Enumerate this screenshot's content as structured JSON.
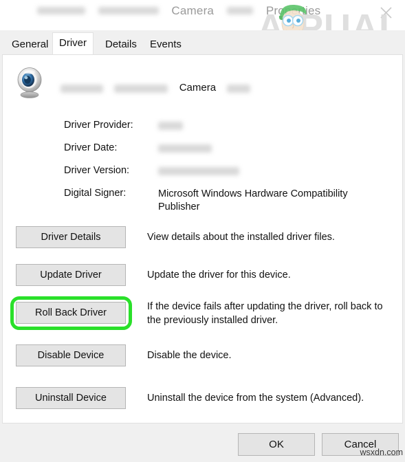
{
  "window": {
    "title_prefix_redacted": true,
    "title_part_visible_1": "Camera",
    "title_part_visible_2": "Properties",
    "close_icon": "close-icon"
  },
  "watermark": {
    "brand": "APPUALS",
    "brand_letter_a": "A",
    "brand_rest": "PUALS",
    "site": "wsxdn.com",
    "cap_color": "#5bc46a",
    "brand_color": "#d9d9d9"
  },
  "tabs": [
    {
      "label": "General",
      "active": false
    },
    {
      "label": "Driver",
      "active": true
    },
    {
      "label": "Details",
      "active": false
    },
    {
      "label": "Events",
      "active": false
    }
  ],
  "device": {
    "icon": "webcam-icon",
    "name_visible": "Camera",
    "name_redacted": true
  },
  "properties": [
    {
      "label": "Driver Provider:",
      "value": "",
      "redacted": true,
      "redacted_width": 36
    },
    {
      "label": "Driver Date:",
      "value": "",
      "redacted": true,
      "redacted_width": 78
    },
    {
      "label": "Driver Version:",
      "value": "",
      "redacted": true,
      "redacted_width": 118
    },
    {
      "label": "Digital Signer:",
      "value": "Microsoft Windows Hardware Compatibility Publisher",
      "redacted": false
    }
  ],
  "actions": [
    {
      "button_label": "Driver Details",
      "description": "View details about the installed driver files.",
      "highlighted": false
    },
    {
      "button_label": "Update Driver",
      "description": "Update the driver for this device.",
      "highlighted": false
    },
    {
      "button_label": "Roll Back Driver",
      "description": "If the device fails after updating the driver, roll back to the previously installed driver.",
      "highlighted": true,
      "highlight_color": "#2ae02a"
    },
    {
      "button_label": "Disable Device",
      "description": "Disable the device.",
      "highlighted": false
    },
    {
      "button_label": "Uninstall Device",
      "description": "Uninstall the device from the system (Advanced).",
      "highlighted": false
    }
  ],
  "footer": {
    "ok_label": "OK",
    "cancel_label": "Cancel"
  }
}
